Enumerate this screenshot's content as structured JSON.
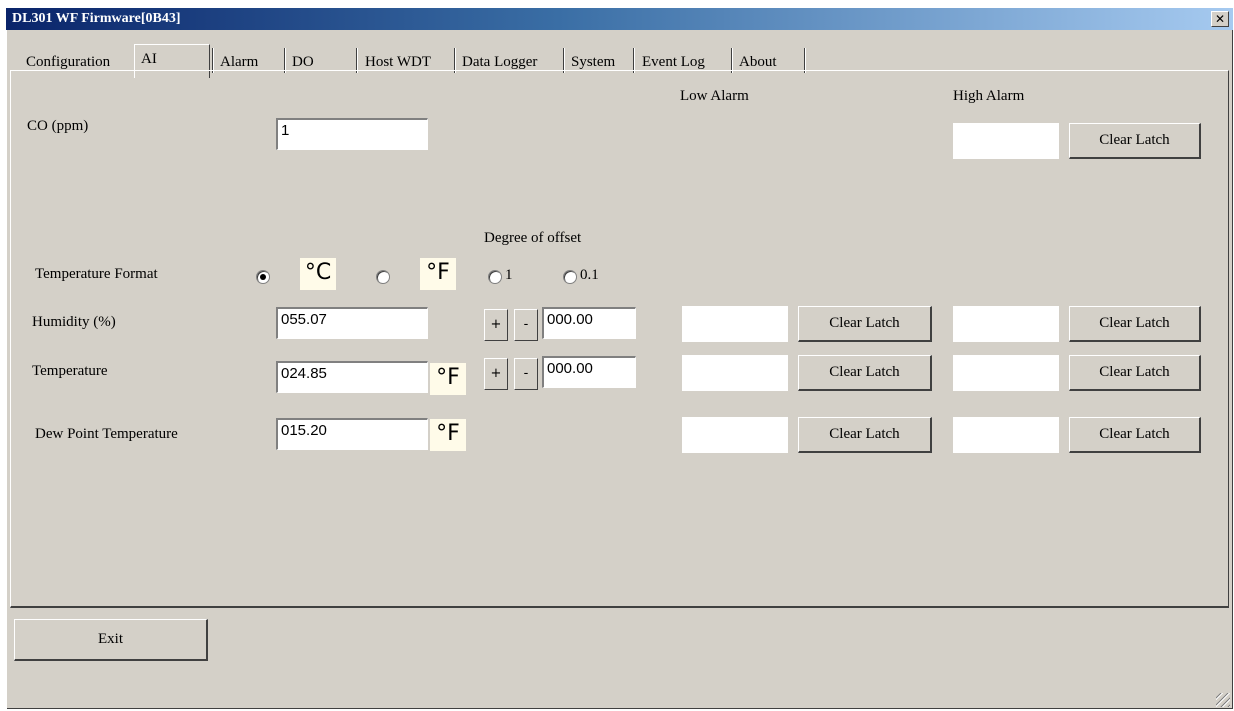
{
  "window": {
    "title": "DL301 WF Firmware[0B43]",
    "close_glyph": "✕"
  },
  "tabs": [
    "Configuration",
    "AI",
    "Alarm",
    "DO",
    "Host WDT",
    "Data Logger",
    "System",
    "Event Log",
    "About"
  ],
  "headers": {
    "low_alarm": "Low Alarm",
    "high_alarm": "High Alarm",
    "degree_of_offset": "Degree of offset"
  },
  "co": {
    "label": "CO (ppm)",
    "value": "1"
  },
  "temp_format": {
    "label": "Temperature Format",
    "celsius": "°C",
    "fahrenheit": "°F",
    "selected": "celsius",
    "offset_opt1": "1",
    "offset_opt2": "0.1"
  },
  "humidity": {
    "label": "Humidity (%)",
    "value": "055.07",
    "offset": "000.00"
  },
  "temperature": {
    "label": "Temperature",
    "value": "024.85",
    "unit": "°F",
    "offset": "000.00"
  },
  "dew_point": {
    "label": "Dew Point Temperature",
    "value": "015.20",
    "unit": "°F"
  },
  "buttons": {
    "plus": "+",
    "minus": "-",
    "clear_latch": "Clear Latch",
    "exit": "Exit"
  }
}
